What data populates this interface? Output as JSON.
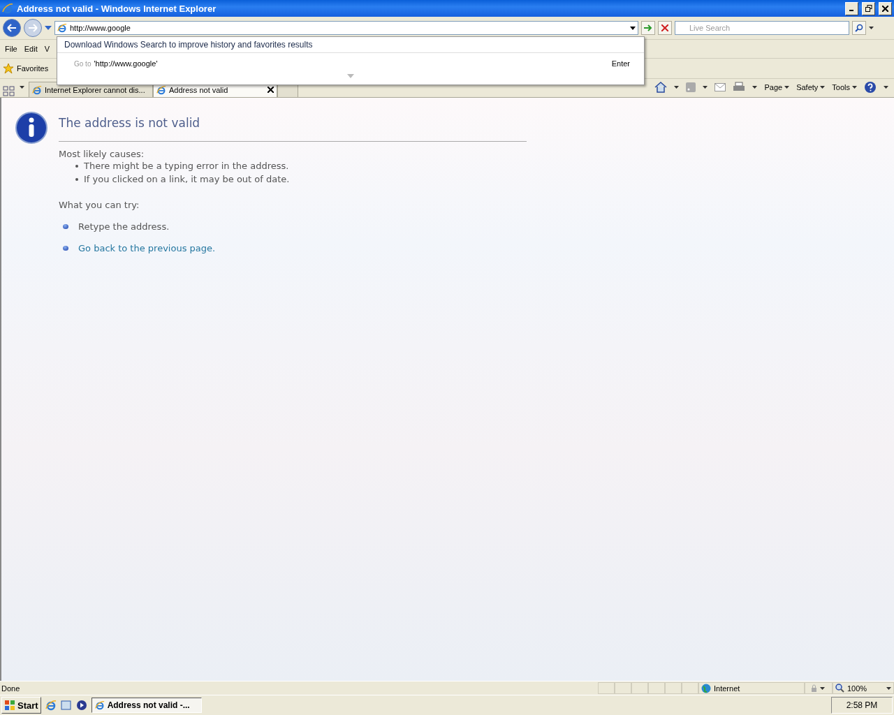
{
  "window": {
    "title": "Address not valid - Windows Internet Explorer"
  },
  "address_bar": {
    "value": "http://www.google"
  },
  "search": {
    "placeholder": "Live Search"
  },
  "autocomplete": {
    "notice": "Download Windows Search to improve history and favorites results",
    "goto_label": "Go to",
    "goto_value": "'http://www.google'",
    "enter": "Enter"
  },
  "menu": [
    "File",
    "Edit",
    "V"
  ],
  "favorites": {
    "label": "Favorites"
  },
  "tabs": [
    {
      "label": "Internet Explorer cannot dis...",
      "selected": false
    },
    {
      "label": "Address not valid",
      "selected": true
    }
  ],
  "command_bar": [
    "Page",
    "Safety",
    "Tools"
  ],
  "page": {
    "title": "The address is not valid",
    "causes_heading": "Most likely causes:",
    "causes": [
      "There might be a typing error in the address.",
      "If you clicked on a link, it may be out of date."
    ],
    "try_heading": "What you can try:",
    "try": [
      {
        "text": "Retype the address.",
        "kind": "text"
      },
      {
        "text": "Go back to the previous page.",
        "kind": "link"
      }
    ]
  },
  "status_bar": {
    "status": "Done",
    "zone": "Internet",
    "zoom": "100%"
  },
  "taskbar": {
    "start": "Start",
    "task": "Address not valid -...",
    "clock": "2:58 PM"
  }
}
